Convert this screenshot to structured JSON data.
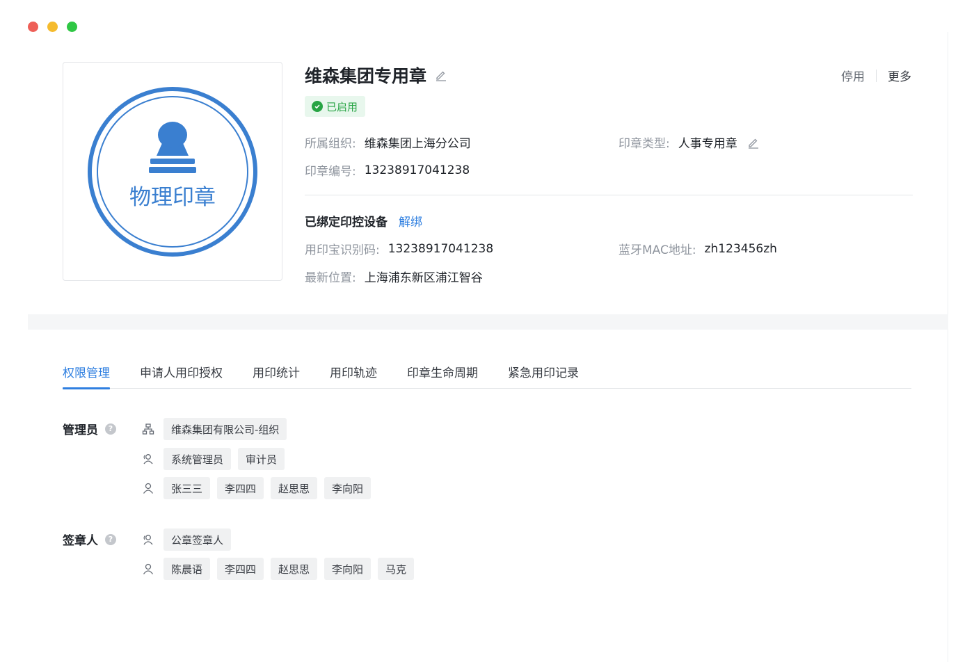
{
  "colors": {
    "accent": "#2f7fe0",
    "success": "#27a444",
    "seal_blue": "#3a7fd0"
  },
  "window": {
    "dots": [
      "#ee5f57",
      "#f5bb2e",
      "#2fc744"
    ]
  },
  "seal": {
    "icon": "stamp-icon",
    "text": "物理印章"
  },
  "header": {
    "title": "维森集团专用章",
    "status": "已启用",
    "actions": {
      "disable": "停用",
      "more": "更多"
    }
  },
  "info": {
    "org_label": "所属组织:",
    "org_value": "维森集团上海分公司",
    "type_label": "印章类型:",
    "type_value": "人事专用章",
    "code_label": "印章编号:",
    "code_value": "13238917041238"
  },
  "device": {
    "heading": "已绑定印控设备",
    "unbind": "解绑",
    "id_label": "用印宝识别码:",
    "id_value": "13238917041238",
    "mac_label": "蓝牙MAC地址:",
    "mac_value": "zh123456zh",
    "loc_label": "最新位置:",
    "loc_value": "上海浦东新区浦江智谷"
  },
  "tabs": [
    {
      "label": "权限管理",
      "active": true
    },
    {
      "label": "申请人用印授权",
      "active": false
    },
    {
      "label": "用印统计",
      "active": false
    },
    {
      "label": "用印轨迹",
      "active": false
    },
    {
      "label": "印章生命周期",
      "active": false
    },
    {
      "label": "紧急用印记录",
      "active": false
    }
  ],
  "permissions": {
    "admins": {
      "label": "管理员",
      "org_chips": [
        "维森集团有限公司-组织"
      ],
      "role_chips": [
        "系统管理员",
        "审计员"
      ],
      "user_chips": [
        "张三三",
        "李四四",
        "赵思思",
        "李向阳"
      ]
    },
    "signers": {
      "label": "签章人",
      "role_chips": [
        "公章签章人"
      ],
      "user_chips": [
        "陈晨语",
        "李四四",
        "赵思思",
        "李向阳",
        "马克"
      ]
    }
  }
}
